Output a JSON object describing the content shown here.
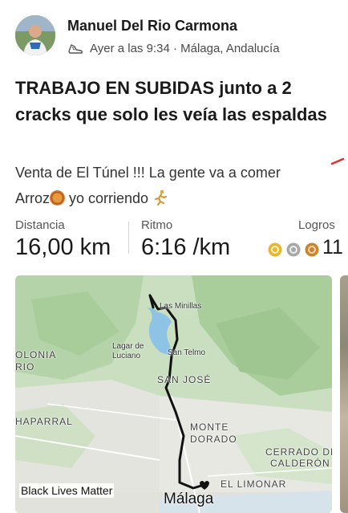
{
  "activity": {
    "author_name": "Manuel Del Rio Carmona",
    "meta": "Ayer a las 9:34 · Málaga, Andalucía",
    "title": "TRABAJO EN SUBIDAS junto a 2 cracks que solo les veía las espaldas",
    "description_line1": "Venta de El Túnel !!! La gente va a comer",
    "description_line2_a": "Arroz",
    "description_line2_b": " yo corriendo ",
    "activity_icon": "running-shoe-icon"
  },
  "stats": {
    "distance_label": "Distancia",
    "distance_value": "16,00 km",
    "pace_label": "Ritmo",
    "pace_value": "6:16 /km",
    "achievements_label": "Logros",
    "achievements_count": "11",
    "medal_colors": [
      "#e8b62a",
      "#a8a8a8",
      "#c8852d"
    ]
  },
  "map": {
    "places": {
      "las_minillas": "Las Minillas",
      "lagar_de": "Lagar de",
      "luciano": "Luciano",
      "san_telmo": "San Telmo",
      "san_jose": "SAN JOSÉ",
      "monte": "MONTE",
      "dorado": "DORADO",
      "cerrado_de": "CERRADO DE",
      "calderon": "CALDERÓN",
      "haparral": "HAPARRAL",
      "olonia": "OLONIA",
      "rio": "RIO",
      "el_limonar": "EL LIMONAR",
      "malaga": "Málaga"
    },
    "badge": "Black Lives Matter",
    "route_color": "#111111",
    "reservoir_color": "#8fc3e6"
  }
}
